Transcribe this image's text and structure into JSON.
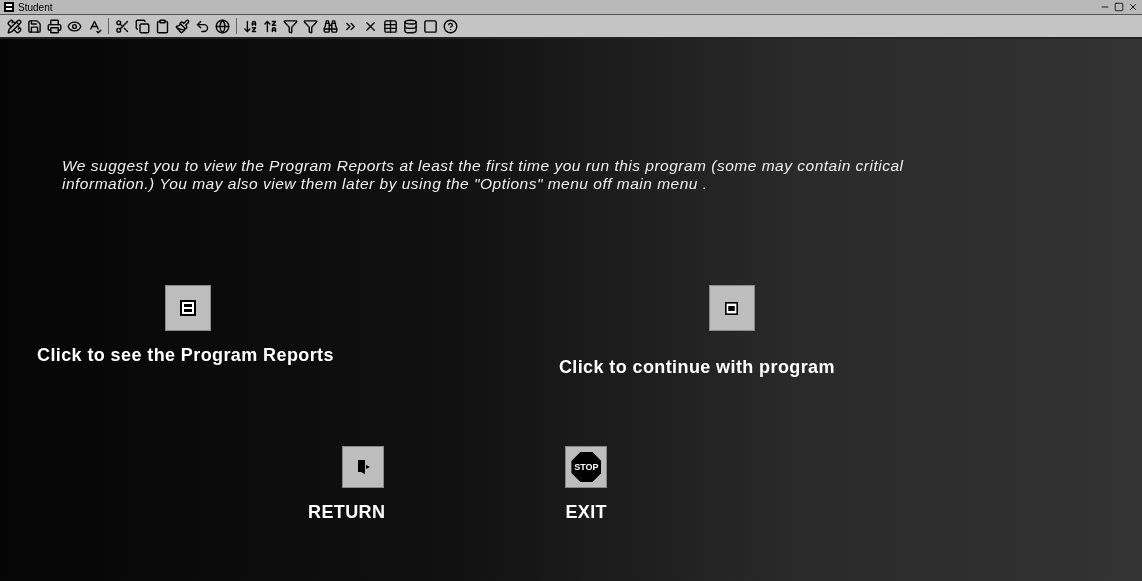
{
  "window": {
    "title": "Student"
  },
  "message": "We suggest you to view the Program Reports at least the first time you run this program (some may contain critical information.) You may also view them later by using the \"Options\" menu off main menu .",
  "actions": [
    {
      "kind": "reports",
      "label": "Click to see the Program Reports"
    },
    {
      "kind": "continue",
      "label": "Click to continue with program"
    }
  ],
  "nav_buttons": [
    {
      "kind": "return",
      "label": "RETURN"
    },
    {
      "kind": "exit",
      "label": "EXIT",
      "icon_text": "STOP"
    }
  ]
}
